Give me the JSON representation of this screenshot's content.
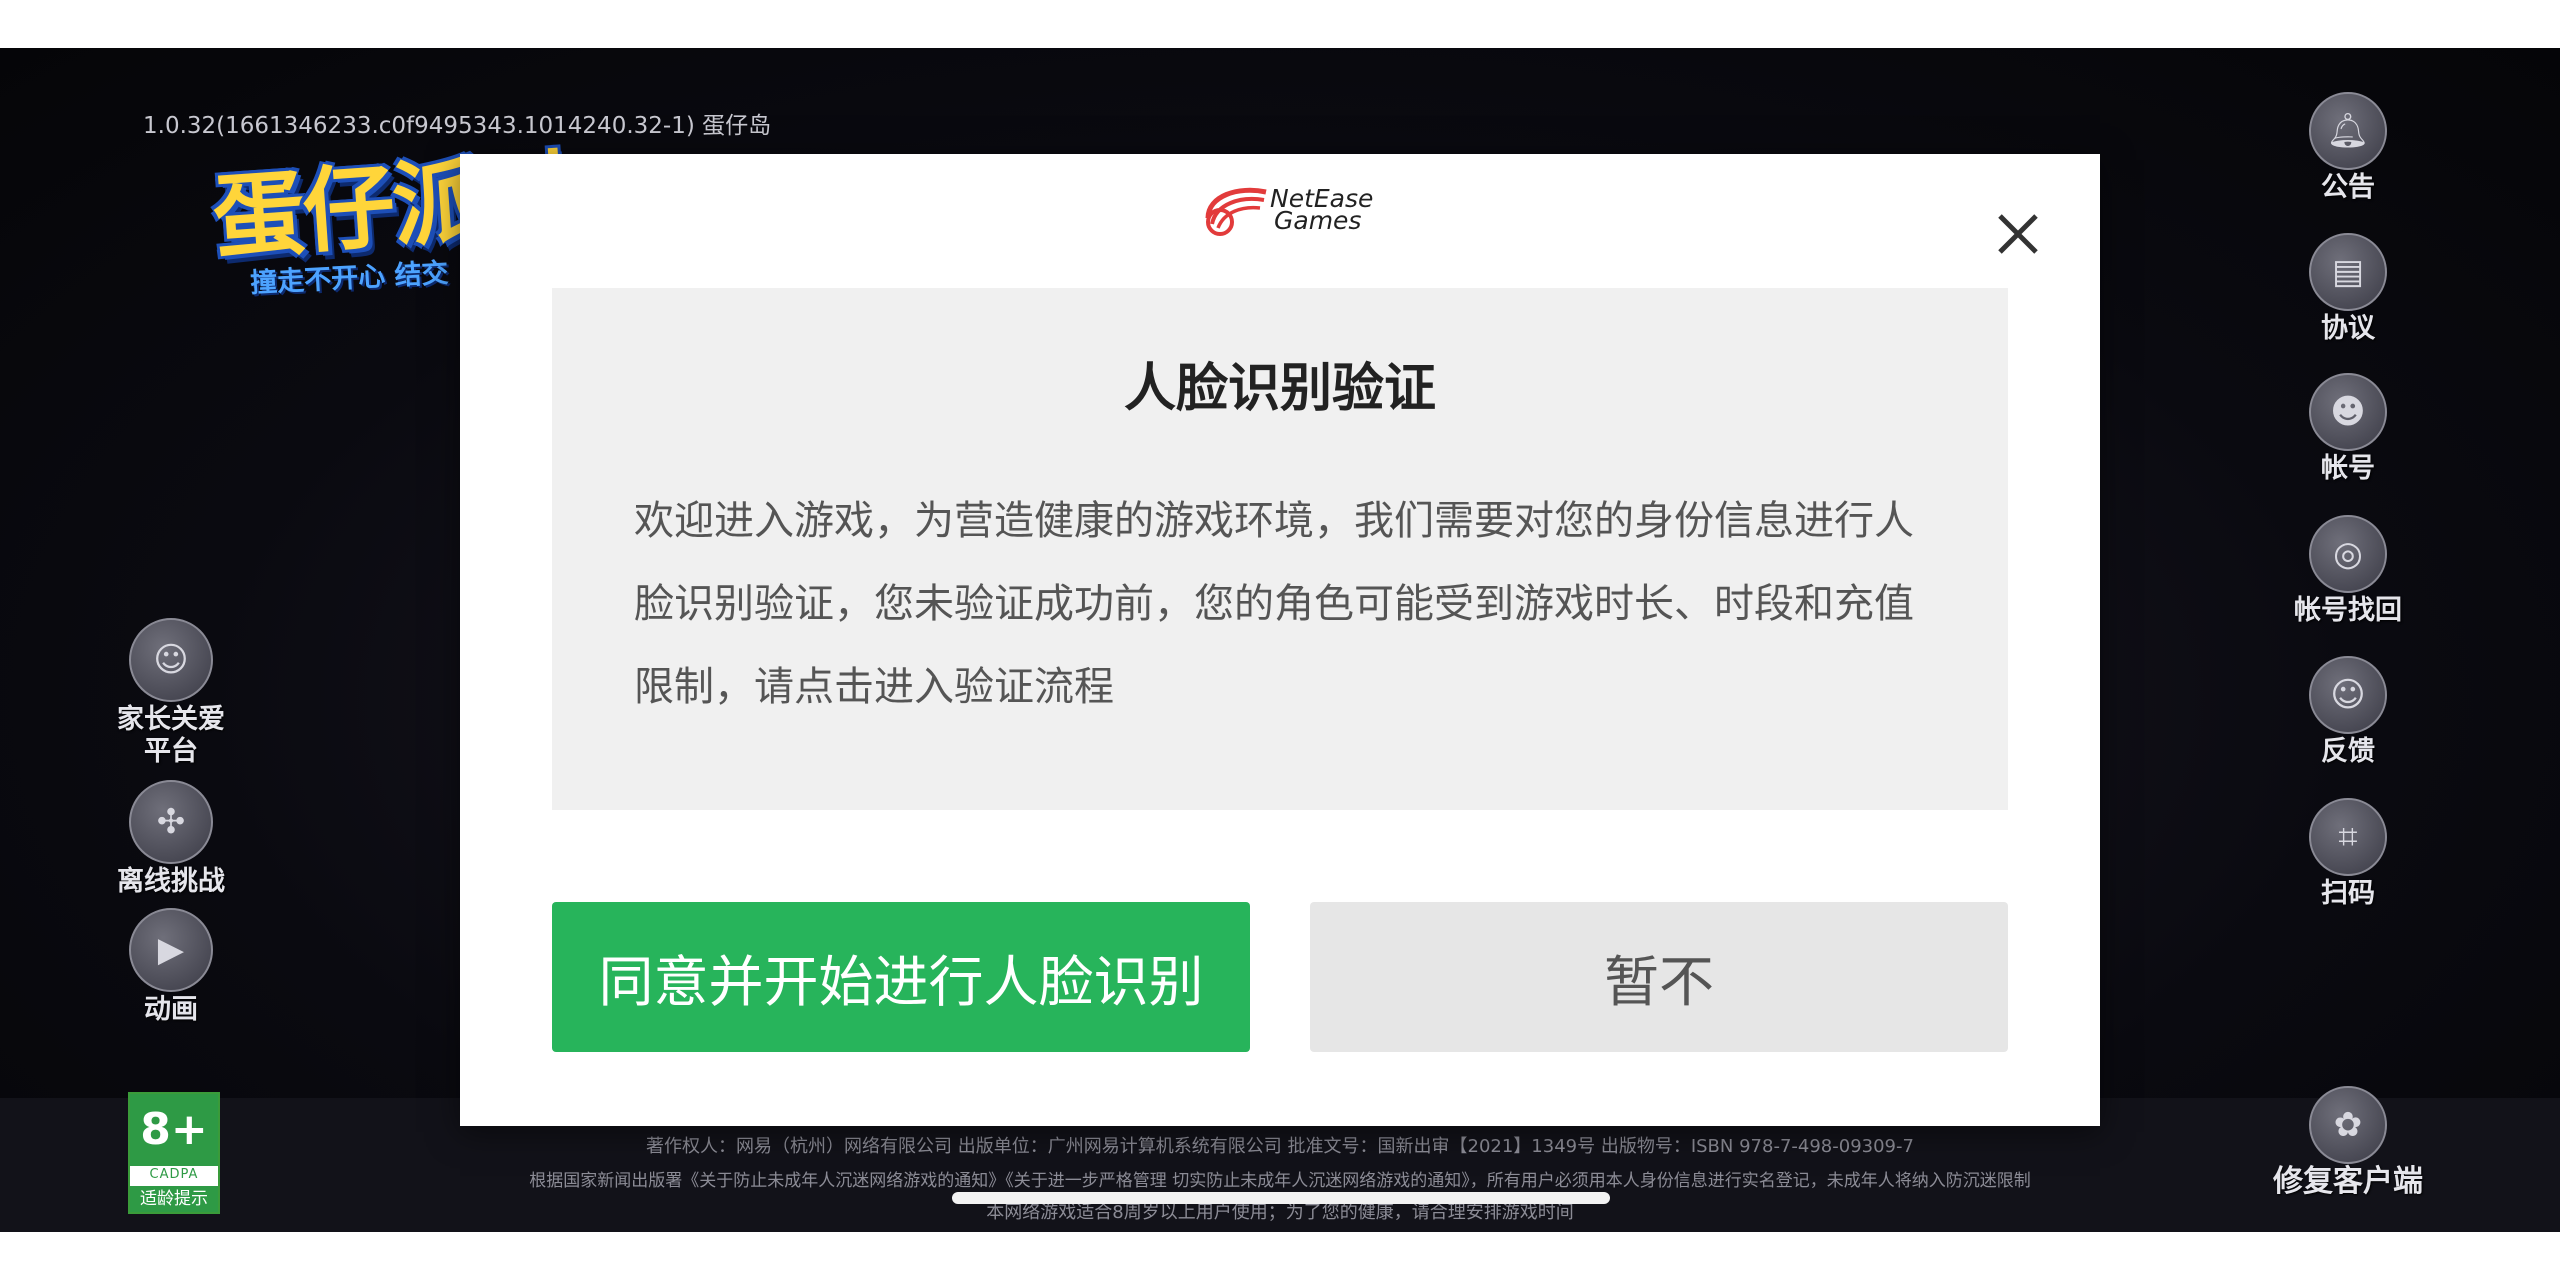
{
  "game": {
    "version": "1.0.32(1661346233.c0f9495343.1014240.32-1)  蛋仔岛",
    "logo_title": "蛋仔派对",
    "logo_subtitle": "撞走不开心  结交",
    "left_buttons": [
      {
        "label": "家长关爱\n平台",
        "icon": "parent-care-icon"
      },
      {
        "label": "离线挑战",
        "icon": "gamepad-icon"
      },
      {
        "label": "动画",
        "icon": "play-icon"
      }
    ],
    "right_buttons": [
      {
        "label": "公告",
        "icon": "bell-icon"
      },
      {
        "label": "协议",
        "icon": "document-icon"
      },
      {
        "label": "帐号",
        "icon": "account-icon"
      },
      {
        "label": "帐号找回",
        "icon": "account-recovery-icon"
      },
      {
        "label": "反馈",
        "icon": "feedback-icon"
      },
      {
        "label": "扫码",
        "icon": "scan-icon"
      },
      {
        "label": "修复客户端",
        "icon": "repair-icon"
      }
    ],
    "age_rating": {
      "age": "8+",
      "org": "CADPA",
      "tip": "适龄提示"
    },
    "legal_lines": [
      "著作权人：网易（杭州）网络有限公司 出版单位：广州网易计算机系统有限公司 批准文号：国新出审【2021】1349号 出版物号：ISBN 978-7-498-09309-7",
      "根据国家新闻出版署《关于防止未成年人沉迷网络游戏的通知》《关于进一步严格管理 切实防止未成年人沉迷网络游戏的通知》，所有用户必须用本人身份信息进行实名登记，未成年人将纳入防沉迷限制",
      "本网络游戏适合8周岁以上用户使用；为了您的健康，请合理安排游戏时间"
    ]
  },
  "modal": {
    "brand_line1": "NetEase",
    "brand_line2": "Games",
    "title": "人脸识别验证",
    "body": "欢迎进入游戏，为营造健康的游戏环境，我们需要对您的身份信息进行人脸识别验证，您未验证成功前，您的角色可能受到游戏时长、时段和充值限制，请点击进入验证流程",
    "agree_button": "同意并开始进行人脸识别",
    "later_button": "暂不",
    "accent_color": "#27b45b"
  }
}
